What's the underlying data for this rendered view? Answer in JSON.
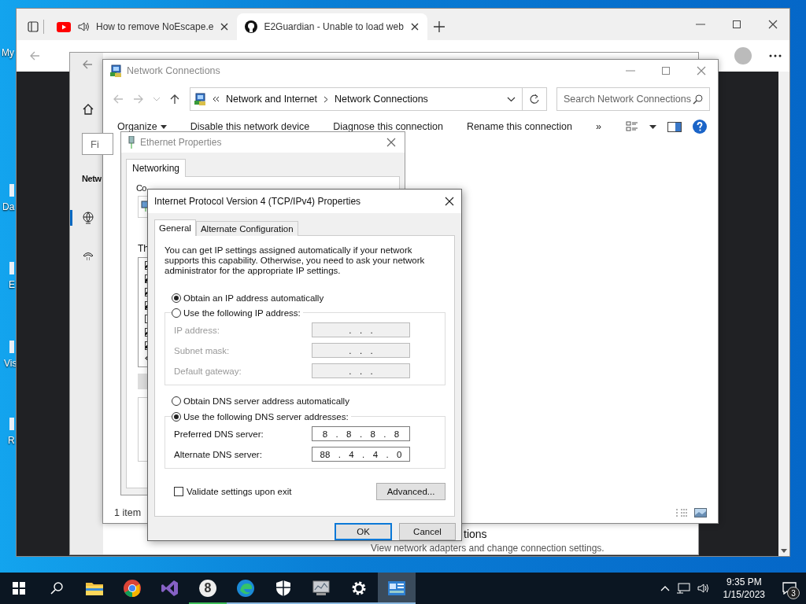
{
  "desktop_icons": [
    {
      "label": "My"
    },
    {
      "label": "Da"
    },
    {
      "label": "E"
    },
    {
      "label": "Vis"
    },
    {
      "label": "R"
    }
  ],
  "browser": {
    "tabs": [
      {
        "title": "How to remove NoEscape.e",
        "selected": false,
        "kind": "video",
        "playing_audio": true
      },
      {
        "title": "E2Guardian - Unable to load web",
        "selected": true,
        "kind": "code",
        "playing_audio": false
      }
    ]
  },
  "settings": {
    "search": {
      "placeholder": "Fi"
    },
    "heading": "Netw",
    "nav": [
      {
        "kind": "globe",
        "selected": true
      },
      {
        "kind": "dialup",
        "selected": false
      }
    ],
    "section_title": "tions",
    "section_text": "View network adapters and change connection settings."
  },
  "network_connections": {
    "title": "Network Connections",
    "breadcrumb": [
      "Network and Internet",
      "Network Connections"
    ],
    "search": {
      "placeholder": "Search Network Connections"
    },
    "commands": [
      {
        "label": "Organize",
        "dropdown": true
      },
      {
        "label": "Disable this network device",
        "dropdown": false
      },
      {
        "label": "Diagnose this connection",
        "dropdown": false
      },
      {
        "label": "Rename this connection",
        "dropdown": false
      }
    ],
    "more": "»",
    "status": "1 item"
  },
  "ethernet_properties": {
    "title": "Ethernet Properties",
    "tabs": [
      {
        "label": "Networking",
        "selected": true
      }
    ],
    "connect_label": "Co",
    "components_label": "Th",
    "components": [
      {
        "checked": true
      },
      {
        "checked": true
      },
      {
        "checked": true
      },
      {
        "checked": true
      },
      {
        "checked": false
      },
      {
        "checked": true
      },
      {
        "checked": true
      }
    ]
  },
  "ipv4_dialog": {
    "title": "Internet Protocol Version 4 (TCP/IPv4) Properties",
    "tabs": [
      {
        "label": "General",
        "selected": true
      },
      {
        "label": "Alternate Configuration",
        "selected": false
      }
    ],
    "intro": "You can get IP settings assigned automatically if your network supports this capability. Otherwise, you need to ask your network administrator for the appropriate IP settings.",
    "ip_options": [
      {
        "label": "Obtain an IP address automatically",
        "selected": true
      },
      {
        "label": "Use the following IP address:",
        "selected": false
      }
    ],
    "ip_fields": [
      {
        "label": "IP address:",
        "value": ".  .  .",
        "disabled": true
      },
      {
        "label": "Subnet mask:",
        "value": ".  .  .",
        "disabled": true
      },
      {
        "label": "Default gateway:",
        "value": ".  .  .",
        "disabled": true
      }
    ],
    "dns_options": [
      {
        "label": "Obtain DNS server address automatically",
        "selected": false
      },
      {
        "label": "Use the following DNS server addresses:",
        "selected": true
      }
    ],
    "dns_fields": [
      {
        "label": "Preferred DNS server:",
        "value": "8  .  8  .  8  .  8",
        "disabled": false
      },
      {
        "label": "Alternate DNS server:",
        "value": "88  .  4  .  4  .  0",
        "disabled": false
      }
    ],
    "validate": {
      "label": "Validate settings upon exit",
      "checked": false
    },
    "advanced_button": "Advanced...",
    "ok_button": "OK",
    "cancel_button": "Cancel"
  },
  "taskbar": {
    "apps": [
      {
        "kind": "start",
        "running": false,
        "selected": false
      },
      {
        "kind": "search",
        "running": false,
        "selected": false
      },
      {
        "kind": "folder",
        "running": false,
        "selected": false
      },
      {
        "kind": "chrome",
        "running": false,
        "selected": false
      },
      {
        "kind": "studio",
        "running": false,
        "selected": false
      },
      {
        "kind": "eight",
        "glyph": "8",
        "running": true,
        "selected": false
      },
      {
        "kind": "edge",
        "running": true,
        "selected": false
      },
      {
        "kind": "shield",
        "running": true,
        "selected": false
      },
      {
        "kind": "monitor",
        "running": true,
        "selected": false
      },
      {
        "kind": "gear",
        "running": true,
        "selected": false
      },
      {
        "kind": "netconn",
        "running": true,
        "selected": true
      }
    ],
    "clock": {
      "time": "9:35 PM",
      "date": "1/15/2023"
    },
    "notifications": "3"
  }
}
